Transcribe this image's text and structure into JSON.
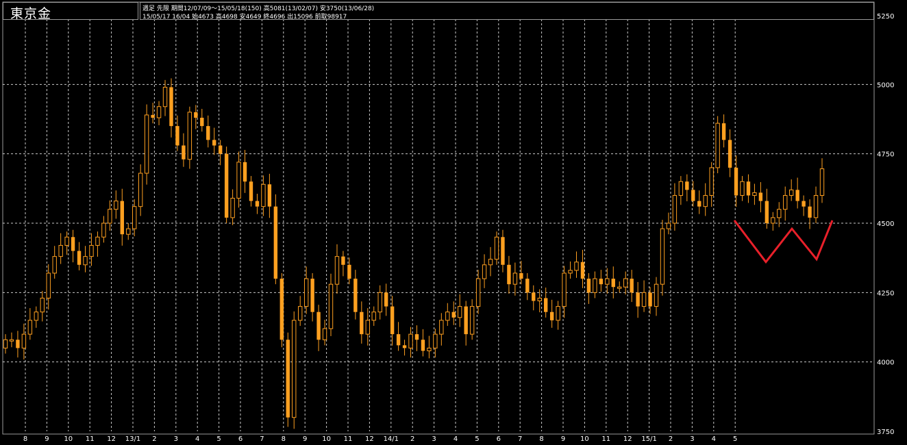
{
  "header": {
    "title": "東京金",
    "info_line1": "週足  先限  期間12/07/09～15/05/18(150) 高5081(13/02/07) 安3750(13/06/28)",
    "info_line2": "15/05/17 16/04 始4673 高4698 安4649 終4696 出15096 前取98917"
  },
  "colors": {
    "background": "#000000",
    "candle": "#ffa020",
    "grid": "#ffffff",
    "annotation": "#e8202a"
  },
  "chart_data": {
    "type": "candlestick",
    "title": "東京金",
    "ylim": [
      3750,
      5250
    ],
    "y_ticks": [
      3750,
      4000,
      4250,
      4500,
      4750,
      5000,
      5250
    ],
    "x_tick_labels": [
      "8",
      "9",
      "10",
      "11",
      "12",
      "13/1",
      "2",
      "3",
      "4",
      "5",
      "6",
      "7",
      "8",
      "9",
      "10",
      "11",
      "12",
      "14/1",
      "2",
      "3",
      "4",
      "5",
      "6",
      "7",
      "8",
      "9",
      "10",
      "11",
      "12",
      "15/1",
      "2",
      "3",
      "4",
      "5"
    ],
    "grid": true,
    "close": [
      4080,
      4080,
      4050,
      4100,
      4150,
      4180,
      4230,
      4320,
      4380,
      4420,
      4450,
      4400,
      4350,
      4380,
      4420,
      4450,
      4500,
      4550,
      4580,
      4460,
      4480,
      4560,
      4680,
      4890,
      4880,
      4920,
      4990,
      4850,
      4780,
      4730,
      4900,
      4880,
      4850,
      4800,
      4780,
      4750,
      4520,
      4590,
      4720,
      4650,
      4580,
      4560,
      4640,
      4560,
      4300,
      4080,
      3800,
      4150,
      4200,
      4300,
      4180,
      4080,
      4120,
      4280,
      4380,
      4350,
      4300,
      4180,
      4100,
      4150,
      4180,
      4250,
      4200,
      4100,
      4060,
      4050,
      4100,
      4080,
      4040,
      4050,
      4100,
      4150,
      4180,
      4160,
      4200,
      4100,
      4200,
      4300,
      4350,
      4370,
      4450,
      4350,
      4280,
      4320,
      4300,
      4250,
      4220,
      4230,
      4180,
      4150,
      4200,
      4320,
      4330,
      4360,
      4300,
      4250,
      4300,
      4280,
      4300,
      4270,
      4270,
      4300,
      4250,
      4200,
      4250,
      4200,
      4280,
      4480,
      4500,
      4600,
      4650,
      4620,
      4580,
      4560,
      4600,
      4700,
      4860,
      4800,
      4700,
      4600,
      4650,
      4600,
      4610,
      4580,
      4500,
      4520,
      4550,
      4600,
      4620,
      4580,
      4560,
      4520,
      4600,
      4696
    ],
    "annotation": {
      "type": "W-shape",
      "description_points": [
        [
          4510,
          "start"
        ],
        [
          4360,
          "low1"
        ],
        [
          4480,
          "mid"
        ],
        [
          4370,
          "low2"
        ],
        [
          4510,
          "end"
        ]
      ]
    }
  }
}
